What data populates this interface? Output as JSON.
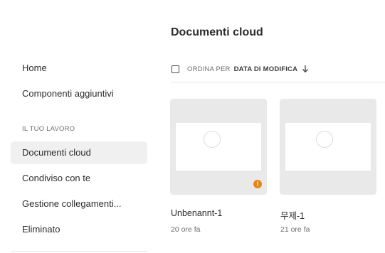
{
  "sidebar": {
    "items": [
      {
        "label": "Home"
      },
      {
        "label": "Componenti aggiuntivi"
      }
    ],
    "section_label": "IL TUO LAVORO",
    "work_items": [
      {
        "label": "Documenti cloud",
        "active": true
      },
      {
        "label": "Condiviso con te"
      },
      {
        "label": "Gestione collegamenti..."
      },
      {
        "label": "Eliminato"
      }
    ]
  },
  "main": {
    "title": "Documenti cloud",
    "sort": {
      "prefix": "ORDINA PER",
      "value": "DATA DI MODIFICA",
      "arrow_icon": "arrow-down-icon"
    },
    "documents": [
      {
        "name": "Unbenannt-1",
        "modified": "20 ore fa",
        "warning": true,
        "warning_glyph": "!"
      },
      {
        "name": "무제-1",
        "modified": "21 ore fa",
        "warning": false
      }
    ]
  },
  "colors": {
    "warning": "#e68619",
    "active_bg": "#f0f0f0",
    "card_bg": "#e9e9e9"
  }
}
